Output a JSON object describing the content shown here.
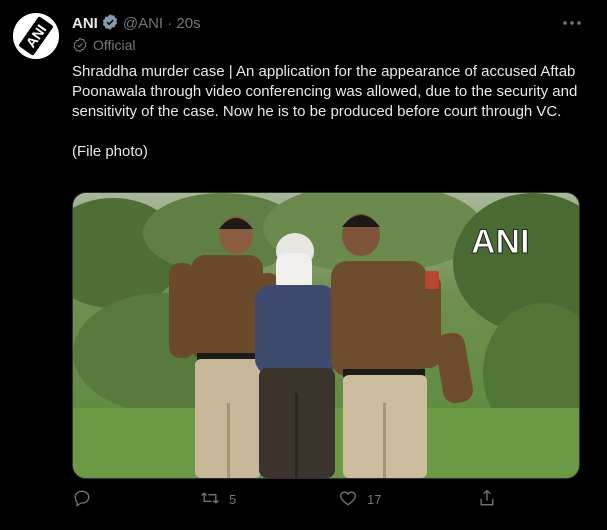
{
  "tweet": {
    "author": {
      "name": "ANI",
      "handle": "@ANI",
      "separator": "·",
      "time": "20s",
      "badge": "Official",
      "avatar_label": "ANI"
    },
    "text": [
      "Shraddha murder case | An application for the appearance of accused Aftab Poonawala through video conferencing was allowed, due to the security and sensitivity of the case. Now he is to be produced before court through VC.",
      "(File photo)"
    ],
    "media": {
      "watermark": "ANI"
    },
    "actions": {
      "reply": {
        "icon": "reply-icon"
      },
      "retweet": {
        "icon": "retweet-icon",
        "count": "5"
      },
      "like": {
        "icon": "heart-icon",
        "count": "17"
      },
      "share": {
        "icon": "share-icon"
      }
    }
  },
  "colors": {
    "background": "#000000",
    "text": "#e7e9ea",
    "muted": "#71767b",
    "verified": "#829aab"
  }
}
